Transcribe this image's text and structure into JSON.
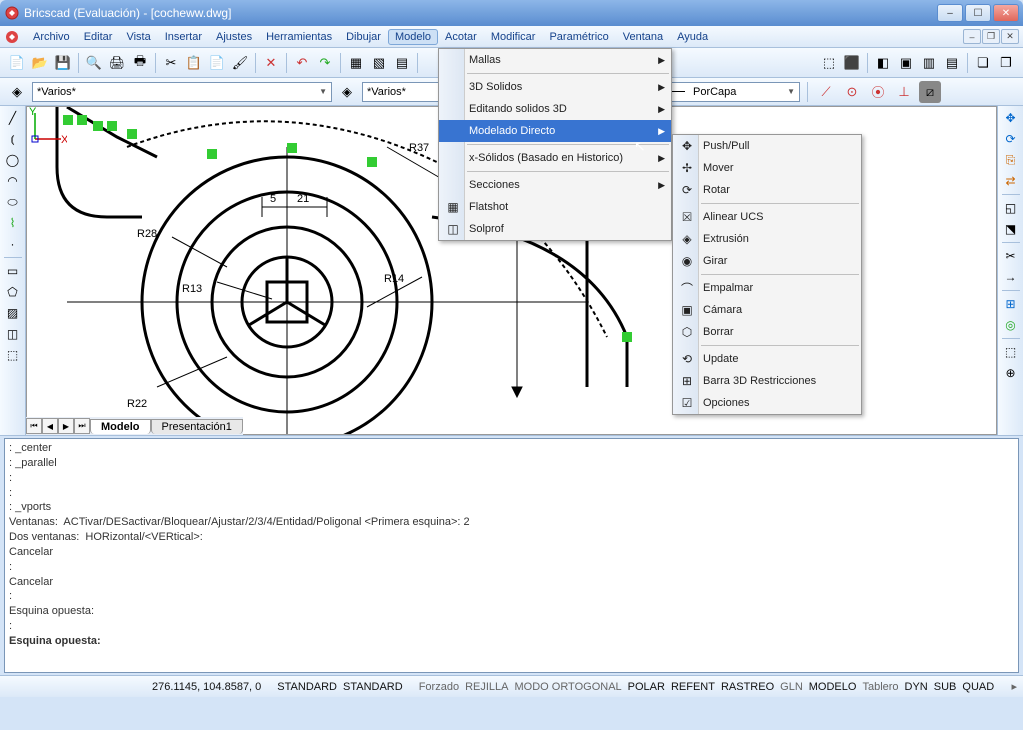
{
  "title": "Bricscad (Evaluación) - [cocheww.dwg]",
  "menubar": [
    "Archivo",
    "Editar",
    "Vista",
    "Insertar",
    "Ajustes",
    "Herramientas",
    "Dibujar",
    "Modelo",
    "Acotar",
    "Modificar",
    "Paramétrico",
    "Ventana",
    "Ayuda"
  ],
  "menu_open_index": 7,
  "layer_combo": "*Varios*",
  "layer_combo2": "*Varios*",
  "linetype_combo": "PorCapa",
  "dropdown_modelo": {
    "items": [
      {
        "label": "Mallas",
        "sub": true
      },
      {
        "sep": true
      },
      {
        "label": "3D Solidos",
        "sub": true
      },
      {
        "label": "Editando solidos 3D",
        "sub": true
      },
      {
        "label": "Modelado Directo",
        "sub": true,
        "hl": true
      },
      {
        "sep": true
      },
      {
        "label": "x-Sólidos (Basado en Historico)",
        "sub": true
      },
      {
        "sep": true
      },
      {
        "label": "Secciones",
        "sub": true
      },
      {
        "label": "Flatshot",
        "icon": "▦"
      },
      {
        "label": "Solprof",
        "icon": "◫"
      }
    ]
  },
  "dropdown_directo": {
    "items": [
      {
        "label": "Push/Pull",
        "icon": "✥"
      },
      {
        "label": "Mover",
        "icon": "✢"
      },
      {
        "label": "Rotar",
        "icon": "⟳"
      },
      {
        "sep": true
      },
      {
        "label": "Alinear UCS",
        "icon": "⮽"
      },
      {
        "label": "Extrusión",
        "icon": "◈"
      },
      {
        "label": "Girar",
        "icon": "◉"
      },
      {
        "sep": true
      },
      {
        "label": "Empalmar",
        "icon": "⌒"
      },
      {
        "label": "Cámara",
        "icon": "▣"
      },
      {
        "label": "Borrar",
        "icon": "⬡"
      },
      {
        "sep": true
      },
      {
        "label": "Update",
        "icon": "⟲"
      },
      {
        "label": "Barra 3D Restricciones",
        "icon": "⊞"
      },
      {
        "label": "Opciones",
        "icon": "☑"
      }
    ]
  },
  "tabs": {
    "active": "Modelo",
    "inactive": "Presentación1"
  },
  "drawing_labels": {
    "r37": "R37",
    "r28": "R28",
    "r13": "R13",
    "r22": "R22",
    "r14": "R14",
    "d5": "5",
    "d21": "21"
  },
  "command_history": [
    ": _center",
    ": _parallel",
    ":",
    ":",
    ": _vports",
    "Ventanas:  ACTivar/DESactivar/Bloquear/Ajustar/2/3/4/Entidad/Poligonal <Primera esquina>: 2",
    "Dos ventanas:  HORizontal/<VERtical>:",
    "Cancelar",
    ":",
    "Cancelar",
    ":",
    "Esquina opuesta:",
    ":"
  ],
  "command_prompt": "Esquina opuesta:",
  "status": {
    "coords": "276.1145, 104.8587, 0",
    "std1": "STANDARD",
    "std2": "STANDARD",
    "items": [
      {
        "t": "Forzado",
        "a": false
      },
      {
        "t": "REJILLA",
        "a": false
      },
      {
        "t": "MODO ORTOGONAL",
        "a": false
      },
      {
        "t": "POLAR",
        "a": true
      },
      {
        "t": "REFENT",
        "a": true
      },
      {
        "t": "RASTREO",
        "a": true
      },
      {
        "t": "GLN",
        "a": false
      },
      {
        "t": "MODELO",
        "a": true
      },
      {
        "t": "Tablero",
        "a": false
      },
      {
        "t": "DYN",
        "a": true
      },
      {
        "t": "SUB",
        "a": true
      },
      {
        "t": "QUAD",
        "a": true
      }
    ]
  }
}
